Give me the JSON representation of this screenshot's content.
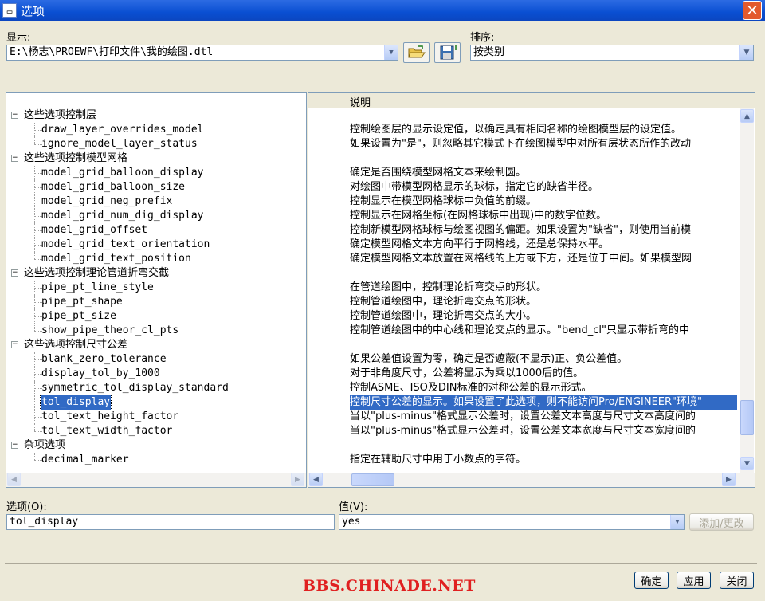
{
  "window": {
    "title": "选项",
    "icon_glyph": "▭",
    "close_glyph": "✕"
  },
  "display": {
    "label": "显示:",
    "label_hotkey": "",
    "path": "E:\\杨志\\PROEWF\\打印文件\\我的绘图.dtl"
  },
  "sort": {
    "label": "排序:",
    "value": "按类别"
  },
  "columns": {
    "description_header": "说明"
  },
  "tree": [
    {
      "type": "category",
      "label": "这些选项控制层"
    },
    {
      "type": "item",
      "label": "draw_layer_overrides_model",
      "desc": "控制绘图层的显示设定值，以确定具有相同名称的绘图模型层的设定值。"
    },
    {
      "type": "item",
      "label": "ignore_model_layer_status",
      "desc": "如果设置为\"是\"，则忽略其它模式下在绘图模型中对所有层状态所作的改动"
    },
    {
      "type": "category",
      "label": "这些选项控制模型网格"
    },
    {
      "type": "item",
      "label": "model_grid_balloon_display",
      "desc": "确定是否围绕模型网格文本来绘制圆。"
    },
    {
      "type": "item",
      "label": "model_grid_balloon_size",
      "desc": "对绘图中带模型网格显示的球标，指定它的缺省半径。"
    },
    {
      "type": "item",
      "label": "model_grid_neg_prefix",
      "desc": "控制显示在模型网格球标中负值的前缀。"
    },
    {
      "type": "item",
      "label": "model_grid_num_dig_display",
      "desc": "控制显示在网格坐标(在网格球标中出现)中的数字位数。"
    },
    {
      "type": "item",
      "label": "model_grid_offset",
      "desc": "控制新模型网格球标与绘图视图的偏距。如果设置为\"缺省\"，则使用当前模"
    },
    {
      "type": "item",
      "label": "model_grid_text_orientation",
      "desc": "确定模型网格文本方向平行于网格线，还是总保持水平。"
    },
    {
      "type": "item",
      "label": "model_grid_text_position",
      "desc": "确定模型网格文本放置在网格线的上方或下方，还是位于中间。如果模型网"
    },
    {
      "type": "category",
      "label": "这些选项控制理论管道折弯交截"
    },
    {
      "type": "item",
      "label": "pipe_pt_line_style",
      "desc": "在管道绘图中，控制理论折弯交点的形状。"
    },
    {
      "type": "item",
      "label": "pipe_pt_shape",
      "desc": "控制管道绘图中，理论折弯交点的形状。"
    },
    {
      "type": "item",
      "label": "pipe_pt_size",
      "desc": "控制管道绘图中，理论折弯交点的大小。"
    },
    {
      "type": "item",
      "label": "show_pipe_theor_cl_pts",
      "desc": "控制管道绘图中的中心线和理论交点的显示。\"bend_cl\"只显示带折弯的中"
    },
    {
      "type": "category",
      "label": "这些选项控制尺寸公差"
    },
    {
      "type": "item",
      "label": "blank_zero_tolerance",
      "desc": "如果公差值设置为零，确定是否遮蔽(不显示)正、负公差值。"
    },
    {
      "type": "item",
      "label": "display_tol_by_1000",
      "desc": "对于非角度尺寸，公差将显示为乘以1000后的值。"
    },
    {
      "type": "item",
      "label": "symmetric_tol_display_standard",
      "desc": "控制ASME、ISO及DIN标准的对称公差的显示形式。"
    },
    {
      "type": "item",
      "label": "tol_display",
      "desc": "控制尺寸公差的显示。如果设置了此选项，则不能访问Pro/ENGINEER\"环境\"",
      "selected": true
    },
    {
      "type": "item",
      "label": "tol_text_height_factor",
      "desc": "当以\"plus-minus\"格式显示公差时，设置公差文本高度与尺寸文本高度间的"
    },
    {
      "type": "item",
      "label": "tol_text_width_factor",
      "desc": "当以\"plus-minus\"格式显示公差时，设置公差文本宽度与尺寸文本宽度间的"
    },
    {
      "type": "category",
      "label": "杂项选项"
    },
    {
      "type": "item",
      "label": "decimal_marker",
      "desc": "指定在辅助尺寸中用于小数点的字符。"
    }
  ],
  "option": {
    "label": "选项(O):",
    "value": "tol_display"
  },
  "value": {
    "label": "值(V):",
    "value": "yes"
  },
  "buttons": {
    "add_change": "添加/更改",
    "ok": "确定",
    "apply": "应用",
    "close": "关闭"
  },
  "watermark": "BBS.CHINADE.NET",
  "icons": {
    "open": "folder-open-icon",
    "save": "save-icon"
  },
  "colors": {
    "selection": "#316ac5",
    "titlebar": "#0a4fd2",
    "watermark": "#e02020"
  }
}
